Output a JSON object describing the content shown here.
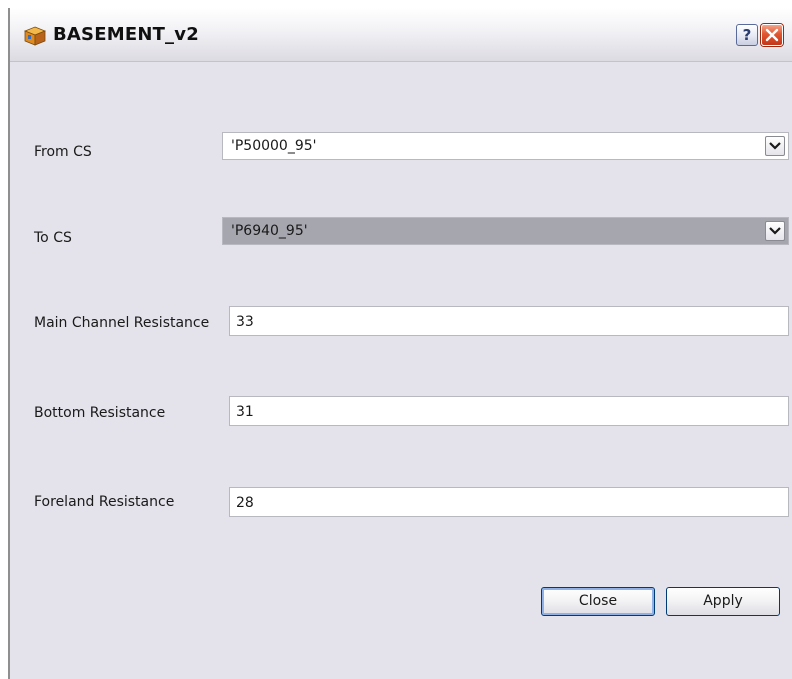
{
  "window": {
    "title": "BASEMENT_v2",
    "help_label": "?"
  },
  "form": {
    "from_cs": {
      "label": "From CS",
      "value": "'P50000_95'"
    },
    "to_cs": {
      "label": "To CS",
      "value": "'P6940_95'"
    },
    "main_channel_resistance": {
      "label": "Main Channel Resistance",
      "value": "33"
    },
    "bottom_resistance": {
      "label": "Bottom Resistance",
      "value": "31"
    },
    "foreland_resistance": {
      "label": "Foreland Resistance",
      "value": "28"
    }
  },
  "buttons": {
    "close_label": "Close",
    "apply_label": "Apply"
  },
  "icons": {
    "app": "cube-icon",
    "help": "help-icon",
    "close": "close-icon",
    "dropdown": "chevron-down-icon"
  },
  "colors": {
    "window_bg": "#e4e3eb",
    "close_button_red": "#e0582f",
    "selected_combo_bg": "#a6a6ae",
    "button_border": "#003c74"
  }
}
